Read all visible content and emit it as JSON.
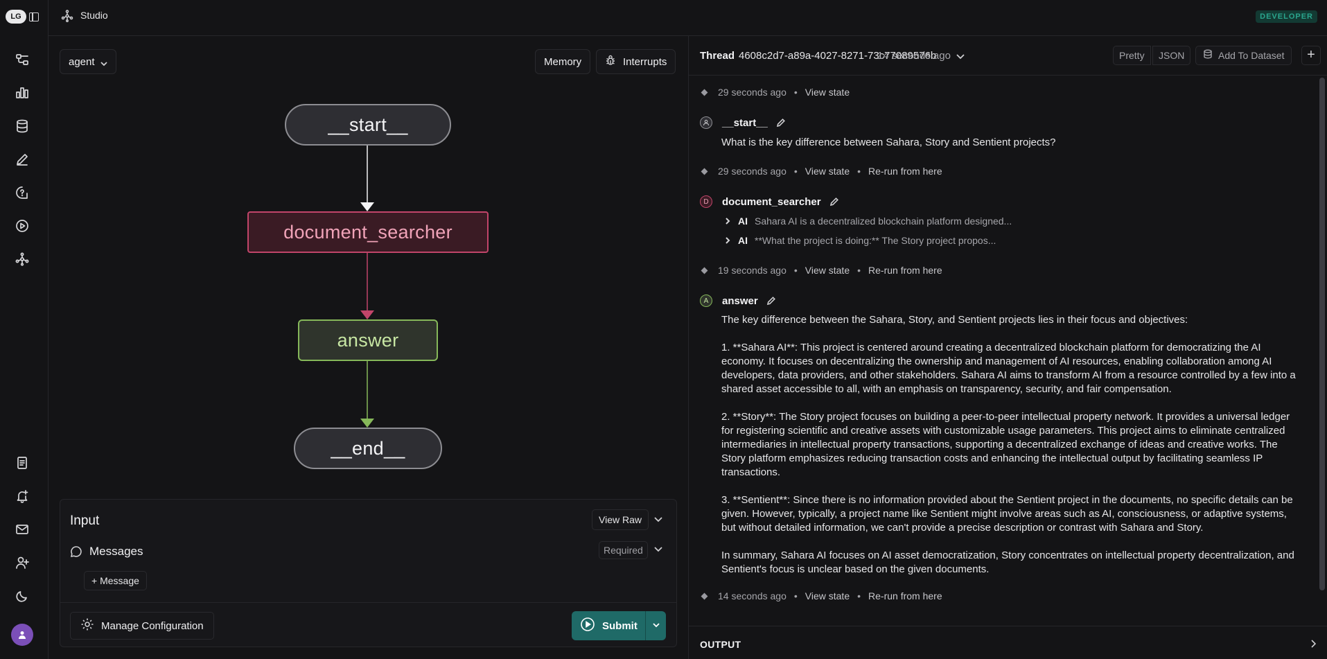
{
  "app": {
    "logo_text": "LG",
    "studio_label": "Studio",
    "badge": "DEVELOPER"
  },
  "rail": {
    "icons": [
      "graph-icon",
      "chart-icon",
      "database-icon",
      "pen-icon",
      "chat-help-icon",
      "play-icon",
      "deploy-icon",
      "docs-icon",
      "bell-plus-icon",
      "mail-icon",
      "user-plus-icon",
      "moon-icon"
    ]
  },
  "graph": {
    "agent_select": "agent",
    "memory_label": "Memory",
    "interrupts_label": "Interrupts",
    "nodes": {
      "start": "__start__",
      "document_searcher": "document_searcher",
      "answer": "answer",
      "end": "__end__"
    },
    "colors": {
      "document_searcher": "#c2456a",
      "answer": "#86b85a",
      "start_end": "#8d8d92"
    }
  },
  "input": {
    "title": "Input",
    "view_raw": "View Raw",
    "messages_label": "Messages",
    "required": "Required",
    "add_message": "Message",
    "manage_config": "Manage Configuration",
    "submit": "Submit"
  },
  "thread": {
    "label": "Thread",
    "id": "4608c2d7-a89a-4027-8271-73c77089576b",
    "time": "14 seconds ago",
    "pretty": "Pretty",
    "json": "JSON",
    "add_to_dataset": "Add To Dataset",
    "plus": "+"
  },
  "feed": {
    "view_state": "View state",
    "rerun": "Re-run from here",
    "checkpoints": [
      "29 seconds ago",
      "29 seconds ago",
      "19 seconds ago",
      "14 seconds ago"
    ],
    "start": {
      "initial": "",
      "name": "__start__",
      "text": "What is the key difference between Sahara, Story and Sentient projects?"
    },
    "searcher": {
      "initial": "D",
      "name": "document_searcher",
      "ai_tag": "AI",
      "ai1": "Sahara AI is a decentralized blockchain platform designed...",
      "ai2": "**What the project is doing:** The Story project propos..."
    },
    "answer": {
      "initial": "A",
      "name": "answer",
      "p0": "The key difference between the Sahara, Story, and Sentient projects lies in their focus and objectives:",
      "p1": "1. **Sahara AI**: This project is centered around creating a decentralized blockchain platform for democratizing the AI economy. It focuses on decentralizing the ownership and management of AI resources, enabling collaboration among AI developers, data providers, and other stakeholders. Sahara AI aims to transform AI from a resource controlled by a few into a shared asset accessible to all, with an emphasis on transparency, security, and fair compensation.",
      "p2": "2. **Story**: The Story project focuses on building a peer-to-peer intellectual property network. It provides a universal ledger for registering scientific and creative assets with customizable usage parameters. This project aims to eliminate centralized intermediaries in intellectual property transactions, supporting a decentralized exchange of ideas and creative works. The Story platform emphasizes reducing transaction costs and enhancing the intellectual output by facilitating seamless IP transactions.",
      "p3": "3. **Sentient**: Since there is no information provided about the Sentient project in the documents, no specific details can be given. However, typically, a project name like Sentient might involve areas such as AI, consciousness, or adaptive systems, but without detailed information, we can't provide a precise description or contrast with Sahara and Story.",
      "p4": "In summary, Sahara AI focuses on AI asset democratization, Story concentrates on intellectual property decentralization, and Sentient's focus is unclear based on the given documents."
    },
    "output_label": "OUTPUT"
  }
}
